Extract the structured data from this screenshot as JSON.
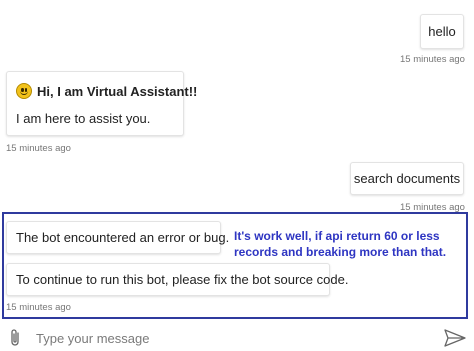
{
  "messages": [
    {
      "from": "user",
      "text": "hello",
      "time": "15 minutes ago"
    },
    {
      "from": "bot",
      "title": "Hi, I am Virtual Assistant!!",
      "text": "I am here to assist you.",
      "time": "15 minutes ago",
      "icon": "smiley-icon"
    },
    {
      "from": "user",
      "text": "search documents",
      "time": "15 minutes ago"
    },
    {
      "from": "bot",
      "texts": [
        "The bot encountered an error or bug.",
        "To continue to run this bot, please fix the bot source code."
      ],
      "time": "15 minutes ago"
    }
  ],
  "annotation": "It's work well, if api return 60 or less records and breaking more than that.",
  "input": {
    "placeholder": "Type your message",
    "value": ""
  },
  "icons": {
    "attach": "paperclip-icon",
    "send": "send-icon"
  },
  "colors": {
    "highlight_border": "#2f3a9e",
    "annotation_text": "#2e35c2"
  }
}
